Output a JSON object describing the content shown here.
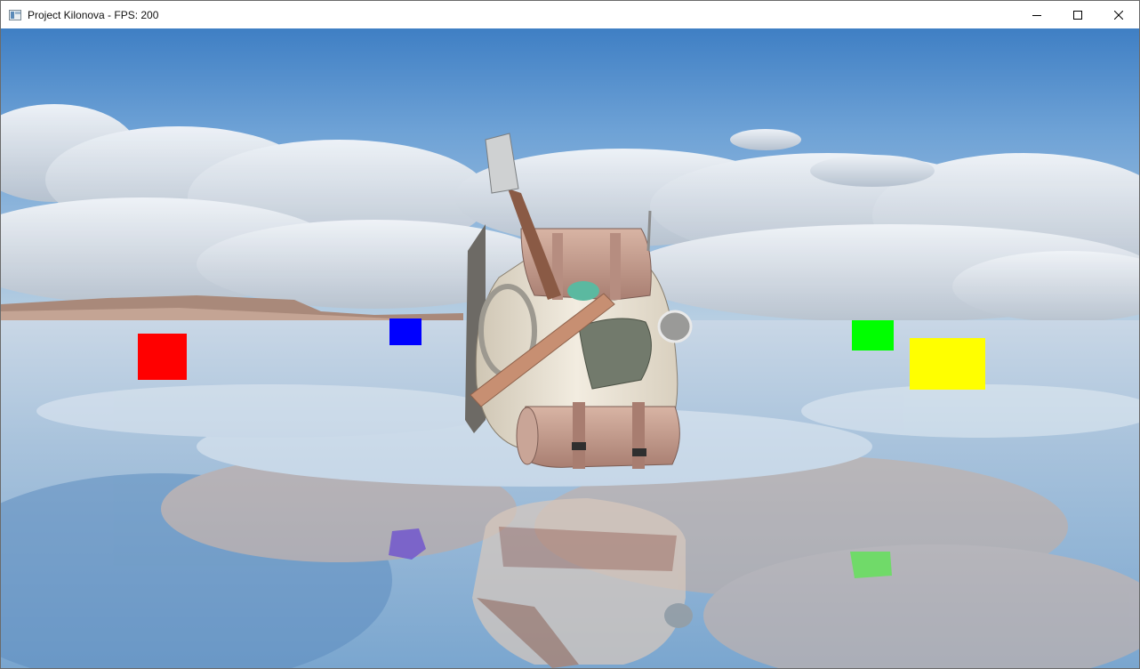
{
  "window": {
    "title": "Project Kilonova - FPS: 200",
    "icon": "app-window-icon",
    "controls": {
      "minimize": "minimize-icon",
      "maximize": "maximize-icon",
      "close": "close-icon"
    }
  },
  "scene": {
    "object": "backpack-model",
    "cubes": [
      {
        "name": "red-cube",
        "color": "#ff0000"
      },
      {
        "name": "blue-cube",
        "color": "#0000ff"
      },
      {
        "name": "green-cube",
        "color": "#00ff00"
      },
      {
        "name": "yellow-cube",
        "color": "#ffff00"
      }
    ],
    "sky_color": "#4f8fcf",
    "water_color": "#8fb6d4"
  }
}
